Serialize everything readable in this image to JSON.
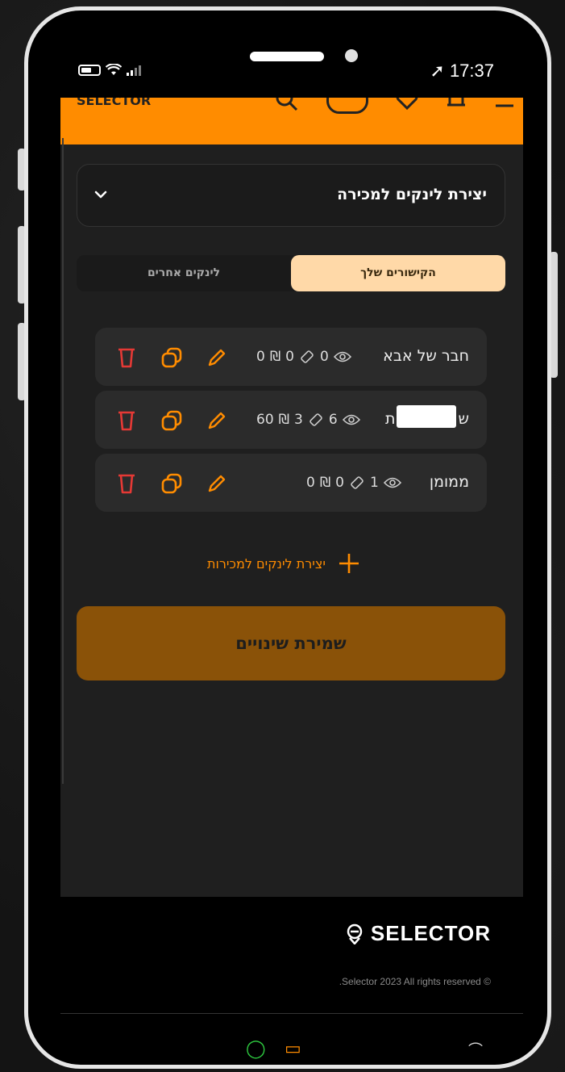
{
  "status_bar": {
    "time": "17:37",
    "location_glyph": "➚"
  },
  "header": {
    "brand_cut": "SELECTOR"
  },
  "section": {
    "title": "יצירת לינקים למכירה"
  },
  "tabs": [
    {
      "label": "הקישורים שלך",
      "active": true
    },
    {
      "label": "לינקים אחרים",
      "active": false
    }
  ],
  "links": [
    {
      "name": "חבר של אבא",
      "views": "0",
      "tickets": "0",
      "revenue": "0",
      "currency": "₪"
    },
    {
      "name": "ש",
      "name_tail": "ת",
      "views": "6",
      "tickets": "3",
      "revenue": "60",
      "currency": "₪"
    },
    {
      "name": "ממומן",
      "views": "1",
      "tickets": "0",
      "revenue": "0",
      "currency": "₪"
    }
  ],
  "add_link": {
    "label": "יצירת לינקים למכירות"
  },
  "save_button": {
    "label": "שמירת שינויים"
  },
  "footer": {
    "brand": "SELECTOR",
    "copyright": ".Selector 2023 All rights reserved ©"
  },
  "colors": {
    "accent": "#ff8c00",
    "delete_red": "#e53935",
    "tab_active": "#ffd9a8",
    "save_bg": "#8a5208"
  }
}
